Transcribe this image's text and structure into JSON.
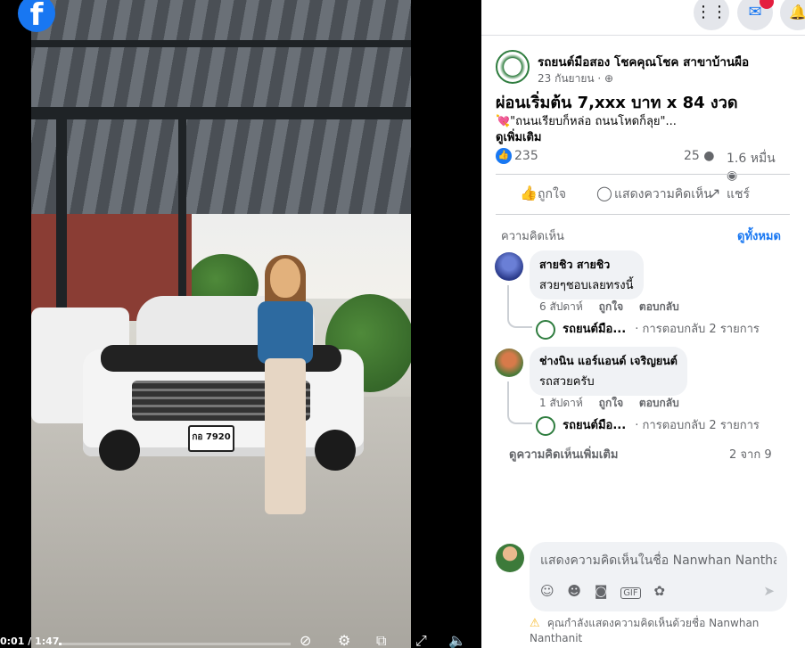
{
  "video": {
    "time": "0:01 / 1:47",
    "progress": 0.01,
    "plate_text": "กอ 7920"
  },
  "topbar": {
    "icons": [
      "grid-menu-icon",
      "messenger-icon",
      "bell-icon"
    ],
    "menu_glyph": "⋮⋮",
    "messenger_glyph": "✉",
    "bell_glyph": "🔔"
  },
  "post": {
    "page_name": "รถยนต์มือสอง โชคคุณโชค สาขาบ้านผือ",
    "date": "23 กันยายน · ⊕",
    "headline": "ผ่อนเริ่มต้น 7,xxx บาท x 84 งวด",
    "body": "💘\"ถนนเรียบก็หล่อ ถนนโหดก็ลุย\"...",
    "see_more": "ดูเพิ่มเติม",
    "like_count": "235",
    "comment_count": "25",
    "view_count": "1.6 หมื่น"
  },
  "actions": {
    "like": "ถูกใจ",
    "comment": "แสดงความคิดเห็น",
    "share": "แชร์"
  },
  "comments_section": {
    "header": "ความคิดเห็น",
    "see_all": "ดูทั้งหมด",
    "items": [
      {
        "name": "สายชิว สายชิว",
        "text": "สวยๆชอบเลยทรงนี้",
        "time": "6 สัปดาห์",
        "like": "ถูกใจ",
        "reply": "ตอบกลับ",
        "reply_name": "รถยนต์มือ...",
        "reply_count": "· การตอบกลับ 2 รายการ"
      },
      {
        "name": "ช่างนิน แอร์แอนด์ เจริญยนต์",
        "text": "รถสวยครับ",
        "time": "1 สัปดาห์",
        "like": "ถูกใจ",
        "reply": "ตอบกลับ",
        "reply_name": "รถยนต์มือ...",
        "reply_count": "· การตอบกลับ 2 รายการ"
      }
    ],
    "more_comments": "ดูความคิดเห็นเพิ่มเติม",
    "pages": "2 จาก 9"
  },
  "composer": {
    "placeholder": "แสดงความคิดเห็นในชื่อ Nanwhan Nanthanit",
    "warning": "คุณกำลังแสดงความคิดเห็นด้วยชื่อ Nanwhan Nanthanit"
  },
  "colors": {
    "facebook_blue": "#1877f2",
    "secondary_text": "#65676b",
    "bubble_bg": "#f0f2f5"
  }
}
